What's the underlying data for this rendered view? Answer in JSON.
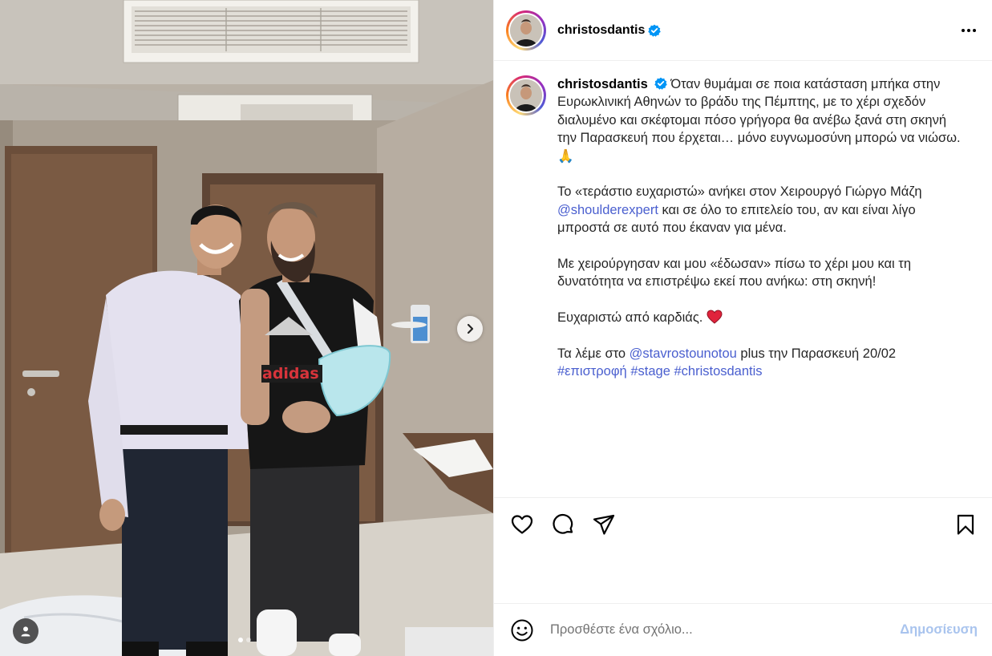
{
  "post": {
    "username": "christosdantis",
    "verified_icon": "verified-badge-icon",
    "more_icon": "more-options-icon"
  },
  "media": {
    "image_alt": "Two men standing in a hospital room, one with arm in a sling",
    "shirt_print": "adidas",
    "carousel_dots": 2,
    "active_dot": 0,
    "next_icon": "chevron-right-icon",
    "tag_icon": "user-tag-icon"
  },
  "caption": {
    "username": "christosdantis",
    "p1": "Όταν θυμάμαι σε ποια κατάσταση μπήκα στην Ευρωκλινική Αθηνών το βράδυ της Πέμπτης, με το χέρι σχεδόν διαλυμένο και σκέφτομαι πόσο γρήγορα θα ανέβω ξανά στη σκηνή την Παρασκευή που έρχεται… μόνο ευγνωμοσύνη μπορώ να νιώσω.",
    "p1_emoji": "🙏",
    "p2_start": "Το «τεράστιο ευχαριστώ» ανήκει στον Χειρουργό Γιώργο Μάζη",
    "p2_mention": "@shoulderexpert",
    "p2_end": " και σε όλο το επιτελείο του, αν και είναι λίγο μπροστά σε αυτό που έκαναν για μένα.",
    "p3": "Με χειρούργησαν και μου «έδωσαν» πίσω το χέρι μου και τη δυνατότητα να επιστρέψω εκεί που ανήκω: στη σκηνή!",
    "p4": "Ευχαριστώ από καρδιάς.",
    "p5_start": "Τα λέμε στο ",
    "p5_mention": "@stavrostounotou",
    "p5_end": " plus την Παρασκευή 20/02",
    "hashtags": [
      "#επιστροφή",
      "#stage",
      "#christosdantis"
    ]
  },
  "actions": {
    "like_icon": "heart-icon",
    "comment_icon": "comment-icon",
    "share_icon": "share-icon",
    "save_icon": "bookmark-icon"
  },
  "comment": {
    "emoji_icon": "emoji-icon",
    "placeholder": "Προσθέστε ένα σχόλιο...",
    "post_label": "Δημοσίευση",
    "post_color": "#a9c4ee"
  },
  "colors": {
    "link": "#4a5fcf",
    "verified": "#0095f6",
    "heart": "#e0233c"
  }
}
